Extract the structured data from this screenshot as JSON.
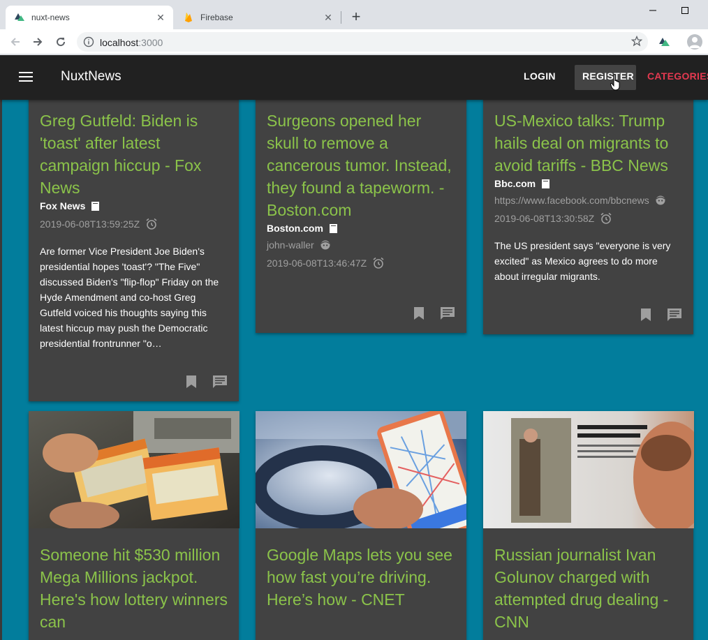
{
  "browser": {
    "tabs": [
      {
        "title": "nuxt-news",
        "active": true
      },
      {
        "title": "Firebase",
        "active": false
      }
    ],
    "url_host": "localhost",
    "url_port": ":3000"
  },
  "app": {
    "brand": "NuxtNews",
    "nav": {
      "login": "LOGIN",
      "register": "REGISTER",
      "categories": "CATEGORIES"
    },
    "colors": {
      "background": "#027d9c",
      "appbar": "#212121",
      "card": "#424242",
      "headline": "#8bc34a",
      "accent": "#e53950"
    }
  },
  "cards": [
    {
      "headline": "Greg Gutfeld: Biden is 'toast' after latest campaign hiccup - Fox News",
      "source": "Fox News",
      "published": "2019-06-08T13:59:25Z",
      "description": "Are former Vice President Joe Biden's presidential hopes 'toast'? \"The Five\" discussed Biden's \"flip-flop\" Friday on the Hyde Amendment and co-host Greg Gutfeld  voiced his thoughts saying this latest hiccup may push the Democratic presidential frontrunner \"o…"
    },
    {
      "headline": "Surgeons opened her skull to remove a cancerous tumor. Instead, they found a tapeworm. - Boston.com",
      "source": "Boston.com",
      "author": "john-waller",
      "published": "2019-06-08T13:46:47Z"
    },
    {
      "headline": "US-Mexico talks: Trump hails deal on migrants to avoid tariffs - BBC News",
      "source": "Bbc.com",
      "author": "https://www.facebook.com/bbcnews",
      "published": "2019-06-08T13:30:58Z",
      "description": "The US president says \"everyone is very excited\" as Mexico agrees to do more about irregular migrants."
    },
    {
      "headline": "Someone hit $530 million Mega Millions jackpot. Here's how lottery winners can",
      "image": "lottery-tickets-photo"
    },
    {
      "headline": "Google Maps lets you see how fast you’re driving. Here’s how - CNET",
      "image": "phone-map-photo"
    },
    {
      "headline": "Russian journalist Ivan Golunov charged with attempted drug dealing - CNN",
      "image": "newspaper-photo"
    }
  ]
}
